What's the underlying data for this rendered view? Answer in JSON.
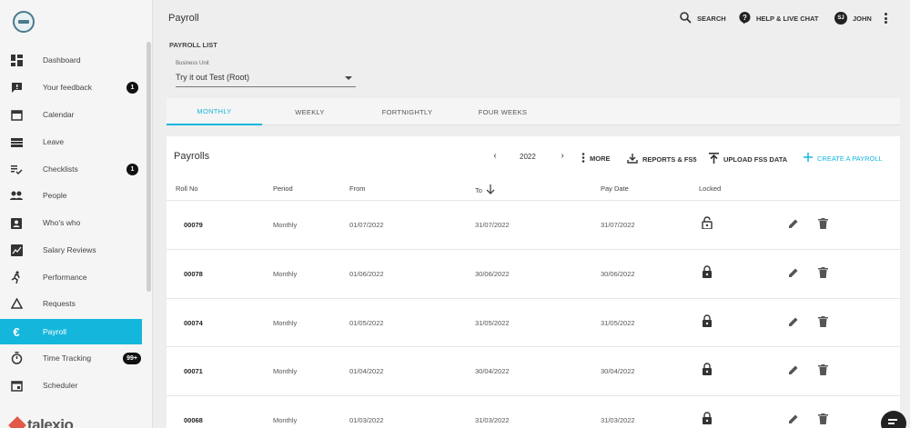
{
  "header": {
    "title": "Payroll",
    "search_label": "SEARCH",
    "help_label": "HELP & LIVE CHAT",
    "user_initials": "SJ",
    "user_name": "JOHN"
  },
  "sidebar": {
    "items": [
      {
        "label": "Dashboard",
        "icon": "dashboard-icon"
      },
      {
        "label": "Your feedback",
        "icon": "feedback-icon",
        "badge": "1"
      },
      {
        "label": "Calendar",
        "icon": "calendar-icon"
      },
      {
        "label": "Leave",
        "icon": "leave-icon"
      },
      {
        "label": "Checklists",
        "icon": "checklist-icon",
        "badge": "1"
      },
      {
        "label": "People",
        "icon": "people-icon"
      },
      {
        "label": "Who's who",
        "icon": "contact-icon"
      },
      {
        "label": "Salary Reviews",
        "icon": "chart-icon"
      },
      {
        "label": "Performance",
        "icon": "run-icon"
      },
      {
        "label": "Requests",
        "icon": "triangle-icon"
      },
      {
        "label": "Payroll",
        "icon": "euro-icon"
      },
      {
        "label": "Time Tracking",
        "icon": "stopwatch-icon",
        "badge": "99+"
      },
      {
        "label": "Scheduler",
        "icon": "calendar-event-icon"
      }
    ],
    "active": "Payroll",
    "brand": "talexio"
  },
  "main": {
    "section_title": "PAYROLL LIST",
    "business_unit": {
      "label": "Business Unit",
      "value": "Try it out Test (Root)"
    },
    "tabs": [
      {
        "label": "MONTHLY"
      },
      {
        "label": "WEEKLY"
      },
      {
        "label": "FORTNIGHTLY"
      },
      {
        "label": "FOUR WEEKS"
      }
    ],
    "active_tab": "MONTHLY",
    "card": {
      "title": "Payrolls",
      "year": "2022",
      "more_label": "MORE",
      "reports_label": "REPORTS & FS5",
      "upload_label": "UPLOAD FSS DATA",
      "create_label": "CREATE A PAYROLL",
      "accent_color": "#15b6dc"
    },
    "columns": [
      "Roll No",
      "Period",
      "From",
      "To",
      "Pay Date",
      "Locked"
    ],
    "sort_column": "To",
    "rows": [
      {
        "roll": "00079",
        "period": "Monthly",
        "from": "01/07/2022",
        "to": "31/07/2022",
        "pay": "31/07/2022",
        "locked": false
      },
      {
        "roll": "00078",
        "period": "Monthly",
        "from": "01/06/2022",
        "to": "30/06/2022",
        "pay": "30/06/2022",
        "locked": true
      },
      {
        "roll": "00074",
        "period": "Monthly",
        "from": "01/05/2022",
        "to": "31/05/2022",
        "pay": "31/05/2022",
        "locked": true
      },
      {
        "roll": "00071",
        "period": "Monthly",
        "from": "01/04/2022",
        "to": "30/04/2022",
        "pay": "30/04/2022",
        "locked": true
      },
      {
        "roll": "00068",
        "period": "Monthly",
        "from": "01/03/2022",
        "to": "31/03/2022",
        "pay": "31/03/2022",
        "locked": true
      }
    ]
  }
}
